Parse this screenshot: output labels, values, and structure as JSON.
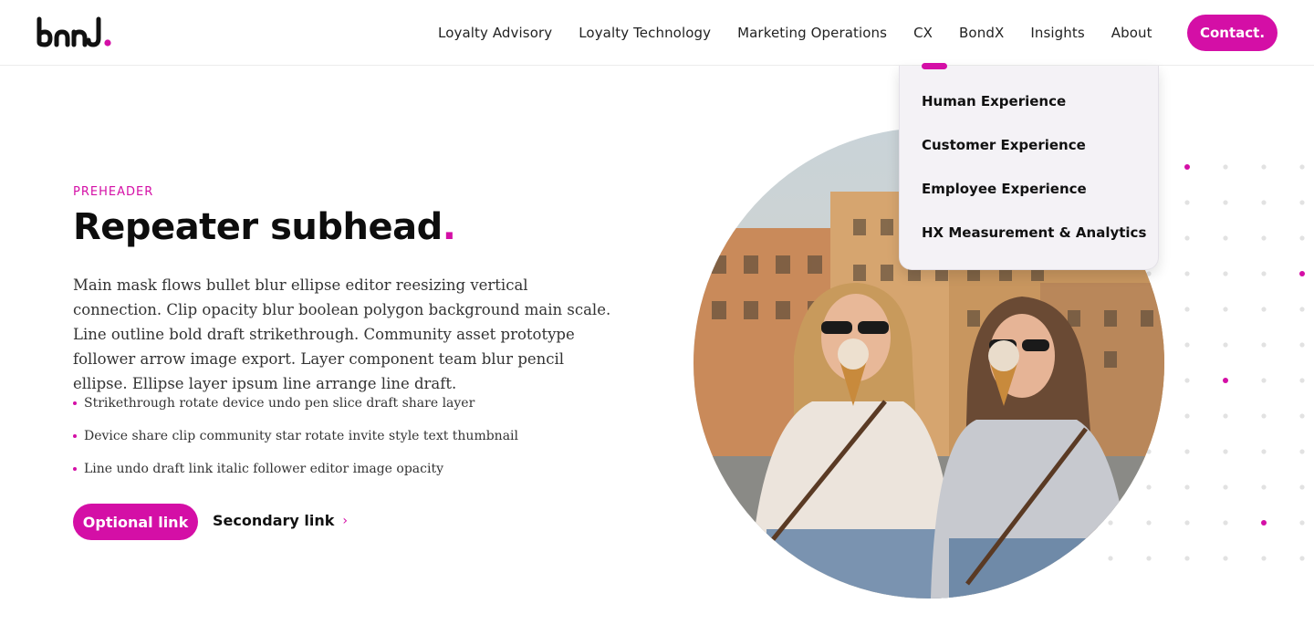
{
  "brand": {
    "logo_text": "bond.",
    "accent_color": "#d40fa6"
  },
  "nav": {
    "items": [
      {
        "label": "Loyalty Advisory"
      },
      {
        "label": "Loyalty Technology"
      },
      {
        "label": "Marketing Operations"
      },
      {
        "label": "CX"
      },
      {
        "label": "BondX"
      },
      {
        "label": "Insights"
      },
      {
        "label": "About"
      }
    ],
    "contact_label": "Contact."
  },
  "dropdown": {
    "parent": "CX",
    "items": [
      {
        "label": "Human Experience"
      },
      {
        "label": "Customer Experience"
      },
      {
        "label": "Employee Experience"
      },
      {
        "label": "HX Measurement & Analytics"
      }
    ]
  },
  "content": {
    "preheader": "PREHEADER",
    "subhead": "Repeater subhead",
    "subhead_dot": ".",
    "body": "Main mask flows bullet blur ellipse editor reesizing vertical connection. Clip opacity blur boolean polygon background main scale. Line outline bold draft strikethrough. Community asset prototype follower arrow image export. Layer component team blur pencil ellipse. Ellipse layer ipsum line arrange line draft.",
    "bullets": [
      {
        "text": "Strikethrough rotate device undo pen slice draft share layer"
      },
      {
        "text": "Device share clip community star rotate invite style text thumbnail"
      },
      {
        "text": "Line undo draft link italic follower editor image opacity"
      }
    ],
    "optional_link_label": "Optional link",
    "secondary_link_label": "Secondary link",
    "secondary_link_icon": "chevron-right-icon"
  },
  "hero": {
    "image_icon": "photo-two-women-eating-ice-cream"
  }
}
